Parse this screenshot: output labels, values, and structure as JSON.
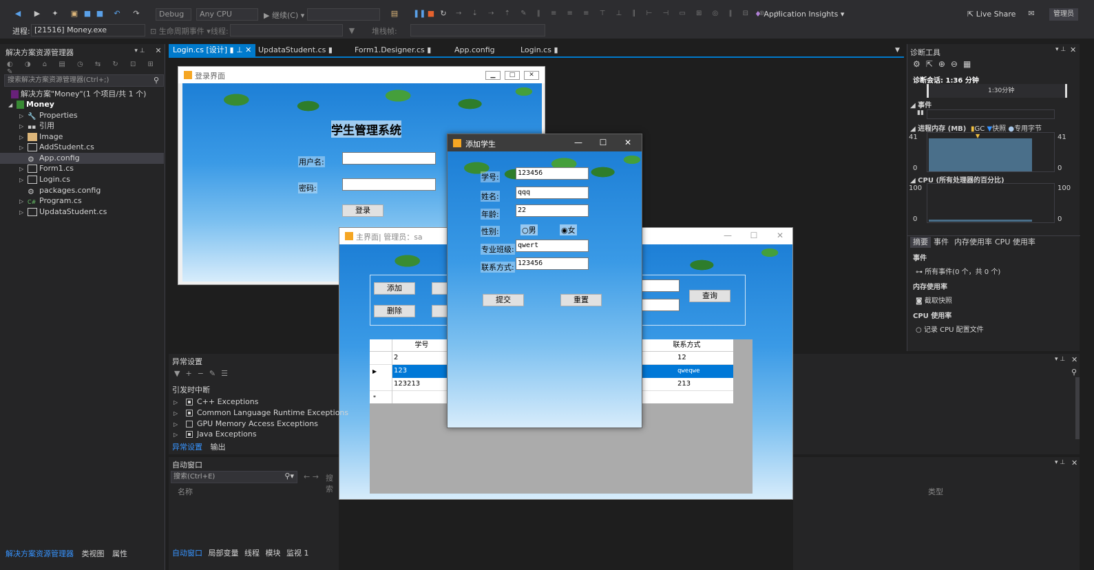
{
  "toolbar": {
    "config": "Debug",
    "platform": "Any CPU",
    "continue_label": "继续(C) ▾",
    "insights": "Application Insights ▾",
    "liveshare": "Live Share",
    "admin": "管理员"
  },
  "toolbar2": {
    "process_label": "进程:",
    "process_value": "[21516] Money.exe",
    "lifecycle": "生命周期事件 ▾",
    "thread_label": "线程:",
    "stackframe_label": "堆栈帧:"
  },
  "solution": {
    "title": "解决方案资源管理器",
    "search_placeholder": "搜索解决方案资源管理器(Ctrl+;)",
    "root": "解决方案\"Money\"(1 个项目/共 1 个)",
    "project": "Money",
    "items": [
      {
        "label": "Properties"
      },
      {
        "label": "引用"
      },
      {
        "label": "Image"
      },
      {
        "label": "AddStudent.cs"
      },
      {
        "label": "App.config"
      },
      {
        "label": "Form1.cs"
      },
      {
        "label": "Login.cs"
      },
      {
        "label": "packages.config"
      },
      {
        "label": "Program.cs"
      },
      {
        "label": "UpdataStudent.cs"
      }
    ],
    "bottom_tabs": [
      "解决方案资源管理器",
      "类视图",
      "属性"
    ]
  },
  "tabs": [
    {
      "label": "Login.cs [设计]"
    },
    {
      "label": "UpdataStudent.cs"
    },
    {
      "label": "Form1.Designer.cs"
    },
    {
      "label": "App.config"
    },
    {
      "label": "Login.cs"
    }
  ],
  "login_form": {
    "title": "登录界面",
    "heading": "学生管理系统",
    "user_label": "用户名:",
    "pwd_label": "密码:",
    "login_btn": "登录"
  },
  "main_form": {
    "title": "主界面| 管理员：sa",
    "add_btn": "添加",
    "delete_btn": "删除",
    "query_btn": "查询",
    "grid_headers": [
      "学号",
      "联系方式"
    ],
    "rows": [
      {
        "id": "2",
        "contact": "12"
      },
      {
        "id": "123",
        "contact": "qweqwe"
      },
      {
        "id": "123213",
        "contact": "213"
      }
    ],
    "new_row_marker": "*"
  },
  "add_form": {
    "title": "添加学生",
    "id_label": "学号:",
    "id_value": "123456",
    "name_label": "姓名:",
    "name_value": "qqq",
    "age_label": "年龄:",
    "age_value": "22",
    "gender_label": "性别:",
    "male": "男",
    "female": "女",
    "major_label": "专业班级:",
    "major_value": "qwert",
    "contact_label": "联系方式:",
    "contact_value": "123456",
    "submit": "提交",
    "reset": "重置"
  },
  "exceptions": {
    "title": "异常设置",
    "break_label": "引发时中断",
    "items": [
      {
        "label": "C++ Exceptions"
      },
      {
        "label": "Common Language Runtime Exceptions"
      },
      {
        "label": "GPU Memory Access Exceptions"
      },
      {
        "label": "Java Exceptions"
      }
    ],
    "tabs": [
      "异常设置",
      "输出"
    ]
  },
  "autos": {
    "title": "自动窗口",
    "search_placeholder": "搜索(Ctrl+E)",
    "search_depth": "搜索",
    "col_name": "名称",
    "col_type": "类型",
    "bottom_tabs": [
      "自动窗口",
      "局部变量",
      "线程",
      "模块",
      "监视 1"
    ]
  },
  "diag": {
    "title": "诊断工具",
    "session": "诊断会话: 1:36 分钟",
    "timeline": "1:30分钟",
    "events": "事件",
    "memory_title": "进程内存 (MB)",
    "legend": [
      "GC",
      "快照",
      "专用字节"
    ],
    "mem_max": "41",
    "mem_min": "0",
    "cpu_title": "CPU (所有处理器的百分比)",
    "cpu_max": "100",
    "cpu_min": "0",
    "tabs": [
      "摘要",
      "事件",
      "内存使用率",
      "CPU 使用率"
    ],
    "sec_events": "事件",
    "all_events": "所有事件(0 个，共 0 个)",
    "sec_memory": "内存使用率",
    "snapshot": "截取快照",
    "sec_cpu": "CPU 使用率",
    "cpu_profile": "记录 CPU 配置文件"
  }
}
